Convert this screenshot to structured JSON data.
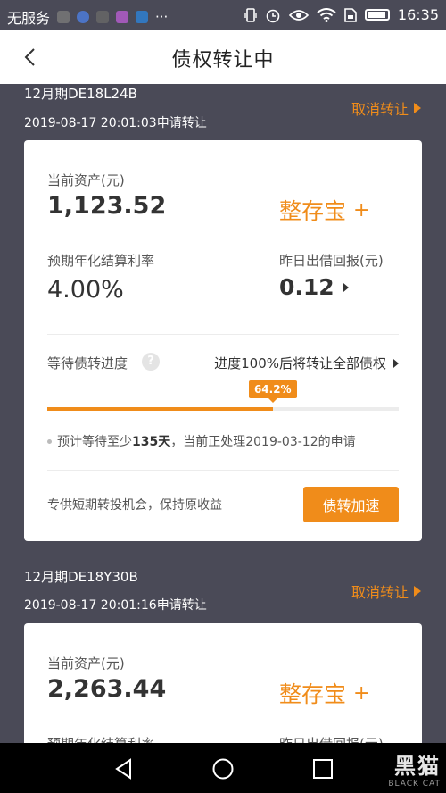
{
  "status_bar": {
    "carrier": "无服务",
    "icons": [
      "usb-icon",
      "shield-icon",
      "link-icon",
      "image-icon",
      "app-icon",
      "more-icon"
    ],
    "right_icons": [
      "vibrate-icon",
      "alarm-icon",
      "eye-icon",
      "wifi-icon",
      "sim-icon",
      "battery-icon"
    ],
    "time": "16:35"
  },
  "header": {
    "title": "债权转让中"
  },
  "transfers": [
    {
      "name": "12月期DE18L24B",
      "applied": "2019-08-17 20:01:03申请转让",
      "cancel_label": "取消转让",
      "asset_label": "当前资产(元)",
      "asset_value": "1,123.52",
      "product": "整存宝",
      "product_plus": "+",
      "rate_label": "预期年化结算利率",
      "rate_value": "4.00%",
      "yesterday_label": "昨日出借回报(元)",
      "yesterday_value": "0.12",
      "progress_label": "等待债转进度",
      "help": "?",
      "progress_rule": "进度100%后将转让全部债权",
      "progress_text": "64.2%",
      "progress": 0.642,
      "wait_prefix": "预计等待至少",
      "wait_days": "135天",
      "wait_suffix": "，当前正处理2019-03-12的申请",
      "promo": "专供短期转投机会，保持原收益",
      "speed_label": "债转加速"
    },
    {
      "name": "12月期DE18Y30B",
      "applied": "2019-08-17 20:01:16申请转让",
      "cancel_label": "取消转让",
      "asset_label": "当前资产(元)",
      "asset_value": "2,263.44",
      "product": "整存宝",
      "product_plus": "+",
      "rate_label": "预期年化结算利率",
      "yesterday_label": "昨日出借回报(元)"
    }
  ],
  "watermark": {
    "big": "黑猫",
    "small": "BLACK CAT"
  },
  "colors": {
    "accent": "#f08c1a",
    "background": "#4a4a57",
    "card": "#ffffff"
  }
}
